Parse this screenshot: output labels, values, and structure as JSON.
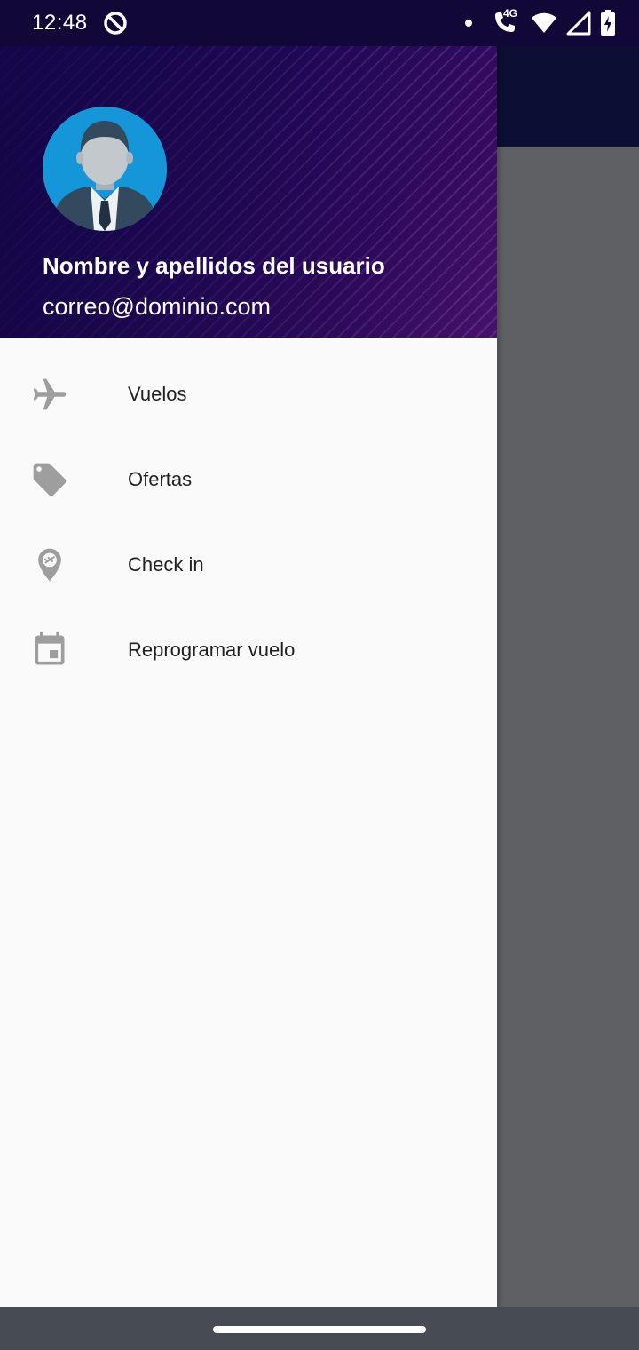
{
  "status_bar": {
    "time": "12:48",
    "network_label": "4G",
    "icons": [
      "sync-icon",
      "notification-dot-icon",
      "wifi-call-icon",
      "wifi-icon",
      "signal-icon",
      "battery-charging-icon"
    ]
  },
  "drawer": {
    "user_name": "Nombre y apellidos del usuario",
    "user_email": "correo@dominio.com",
    "avatar_icon": "user-avatar-icon",
    "items": [
      {
        "label": "Vuelos",
        "icon": "airplane-icon"
      },
      {
        "label": "Ofertas",
        "icon": "tag-icon"
      },
      {
        "label": "Check in",
        "icon": "location-pin-icon"
      },
      {
        "label": "Reprogramar vuelo",
        "icon": "calendar-icon"
      }
    ]
  },
  "colors": {
    "header_dark": "#16075a",
    "header_purple": "#4b136e",
    "avatar_bg": "#1596d8",
    "menu_icon": "#9e9e9e",
    "menu_text": "#212121",
    "scrim": "#5f6064",
    "nav_bar": "#474b53"
  }
}
